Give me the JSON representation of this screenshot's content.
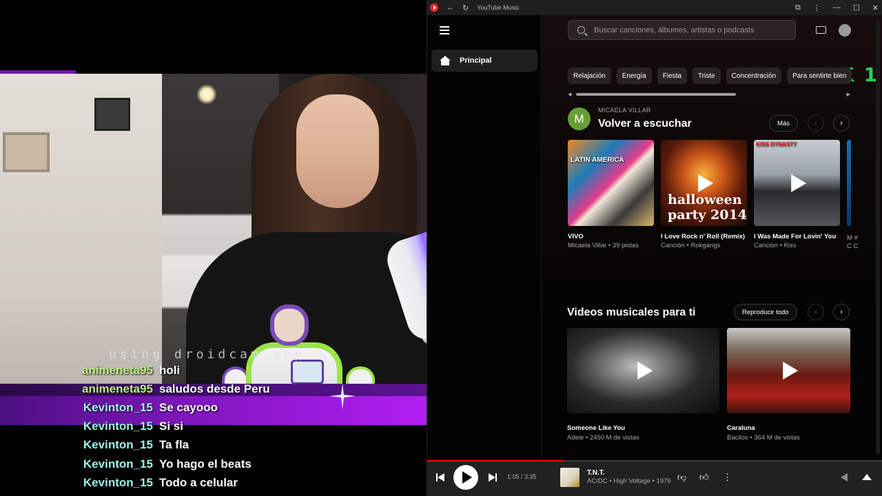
{
  "stream": {
    "watermark": "using droidcam.app",
    "chat": [
      {
        "user": "animeneta95",
        "message": "holi",
        "color": "#b9f27c"
      },
      {
        "user": "animeneta95",
        "message": "saludos desde Peru",
        "color": "#b9f27c"
      },
      {
        "user": "Kevinton_15",
        "message": "Se cayooo",
        "color": "#9df5e4"
      },
      {
        "user": "Kevinton_15",
        "message": "Si si",
        "color": "#9df5e4"
      },
      {
        "user": "Kevinton_15",
        "message": "Ta fla",
        "color": "#9df5e4"
      },
      {
        "user": "Kevinton_15",
        "message": "Yo hago el beats",
        "color": "#9df5e4"
      },
      {
        "user": "Kevinton_15",
        "message": "Todo a celular",
        "color": "#9df5e4"
      }
    ]
  },
  "window": {
    "title": "YouTube Music",
    "icons": [
      "back-arrow-icon",
      "reload-icon",
      "extensions-icon",
      "more-vert-icon",
      "minimize-icon",
      "maximize-icon",
      "close-icon"
    ]
  },
  "nav": {
    "items": [
      {
        "label": "Principal",
        "icon": "home-icon",
        "active": true
      }
    ]
  },
  "search": {
    "placeholder": "Buscar canciones, álbumes, artistas o podcasts"
  },
  "overlay_logo": "K 1",
  "chips": [
    "Relajación",
    "Energía",
    "Fiesta",
    "Triste",
    "Concentración",
    "Para sentirte bien"
  ],
  "section_listen_again": {
    "avatar_letter": "M",
    "kicker": "MICAELA VILLAR",
    "title": "Volver a escuchar",
    "more_label": "Más",
    "cards": [
      {
        "title": "VIVO",
        "subtitle": "Micaela Villar • 39 pistas",
        "art_text": "LATIN AMERICA"
      },
      {
        "title": "I Love Rock n' Roll (Remix)",
        "subtitle": "Canción • Rokgangs",
        "art_text": "halloween party 2014"
      },
      {
        "title": "I Was Made For Lovin' You",
        "subtitle": "Canción • Kiss",
        "art_text": "KISS DYNASTY"
      }
    ],
    "partial_card": {
      "title": "M #",
      "subtitle": "C C"
    }
  },
  "section_videos": {
    "title": "Videos musicales para ti",
    "play_all_label": "Reproducir todo",
    "videos": [
      {
        "title": "Someone Like You",
        "subtitle": "Adele • 2450 M de vistas"
      },
      {
        "title": "Caraluna",
        "subtitle": "Bacilos • 364 M de vistas"
      }
    ]
  },
  "player": {
    "time": "1:05 / 3:35",
    "progress": 0.3,
    "track_title": "T.N.T.",
    "track_subtitle": "AC/DC • High Voltage • 1976"
  }
}
